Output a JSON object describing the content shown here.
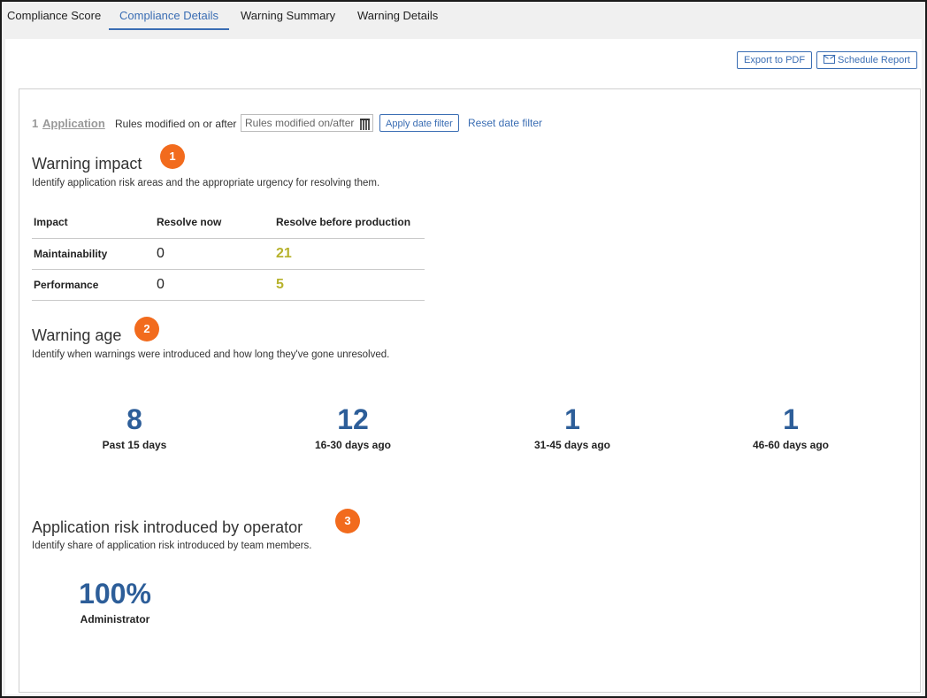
{
  "tabs": [
    {
      "label": "Compliance Score",
      "active": false
    },
    {
      "label": "Compliance Details",
      "active": true
    },
    {
      "label": "Warning Summary",
      "active": false
    },
    {
      "label": "Warning Details",
      "active": false
    }
  ],
  "toolbar": {
    "export_label": "Export to PDF",
    "schedule_label": "Schedule Report"
  },
  "filter": {
    "app_count": "1",
    "app_label": "Application",
    "rules_label": "Rules modified on or after",
    "date_placeholder": "Rules modified on/after",
    "apply_label": "Apply date filter",
    "reset_label": "Reset date filter"
  },
  "sections": {
    "impact": {
      "badge": "1",
      "title": "Warning impact",
      "desc": "Identify application risk areas and the appropriate urgency for resolving them.",
      "headers": [
        "Impact",
        "Resolve now",
        "Resolve before production"
      ],
      "rows": [
        {
          "label": "Maintainability",
          "now": "0",
          "before": "21"
        },
        {
          "label": "Performance",
          "now": "0",
          "before": "5"
        }
      ]
    },
    "age": {
      "badge": "2",
      "title": "Warning age",
      "desc": "Identify when warnings were introduced and how long they've gone unresolved.",
      "stats": [
        {
          "value": "8",
          "label": "Past 15 days"
        },
        {
          "value": "12",
          "label": "16-30 days ago"
        },
        {
          "value": "1",
          "label": "31-45 days ago"
        },
        {
          "value": "1",
          "label": "46-60 days ago"
        }
      ]
    },
    "risk": {
      "badge": "3",
      "title": "Application risk introduced by operator",
      "desc": "Identify share of application risk introduced by team members.",
      "stats": [
        {
          "value": "100%",
          "label": "Administrator"
        }
      ]
    }
  },
  "colors": {
    "accent": "#3a6db3",
    "badge": "#f26b1d",
    "stat_number": "#2d5e99",
    "resolve_before": "#b7b22c"
  }
}
